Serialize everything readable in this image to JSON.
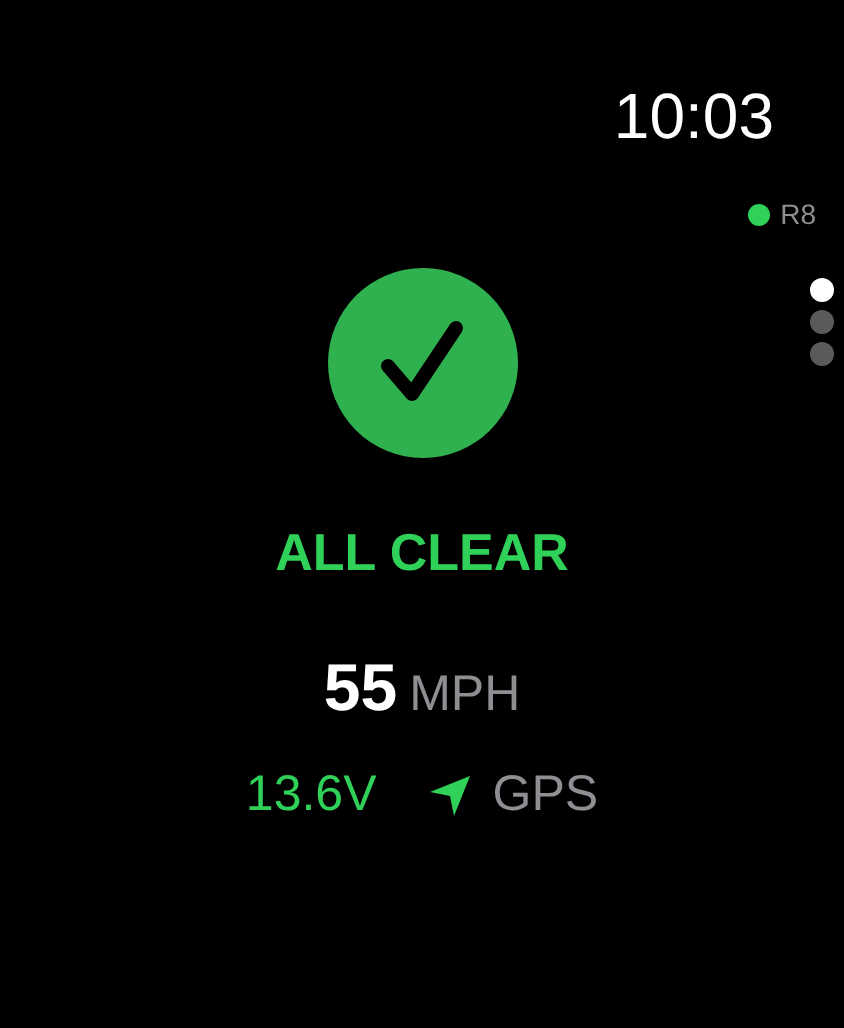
{
  "status_bar": {
    "time": "10:03"
  },
  "device": {
    "label": "R8",
    "color": "#30d158"
  },
  "page_dots": [
    {
      "selected": true
    },
    {
      "selected": false
    },
    {
      "selected": false
    }
  ],
  "status": {
    "title": "ALL CLEAR"
  },
  "speed": {
    "value": "55",
    "unit": "MPH"
  },
  "footer": {
    "voltage": "13.6V",
    "gps_label": "GPS"
  }
}
